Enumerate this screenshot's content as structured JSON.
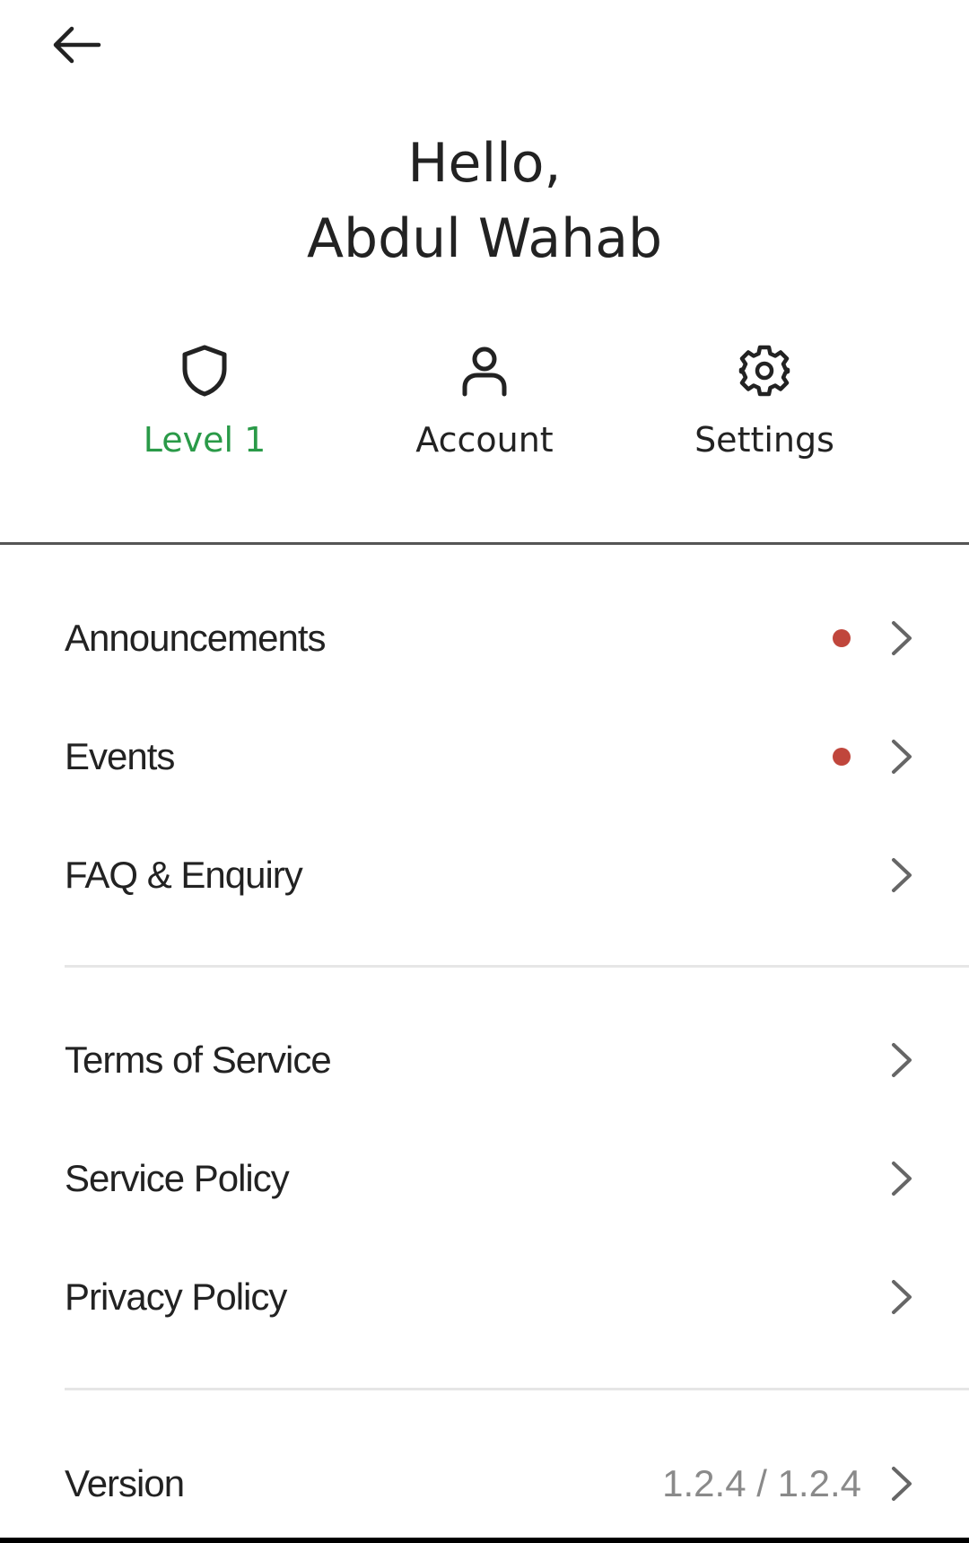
{
  "header": {
    "back_icon": "arrow-left-icon"
  },
  "greeting": {
    "line1": "Hello,",
    "line2": "Abdul Wahab"
  },
  "quick_actions": [
    {
      "label": "Level 1",
      "icon": "shield-icon",
      "color": "#2a9a48"
    },
    {
      "label": "Account",
      "icon": "user-icon",
      "color": "#222222"
    },
    {
      "label": "Settings",
      "icon": "gear-icon",
      "color": "#222222"
    }
  ],
  "menu": {
    "group1": [
      {
        "label": "Announcements",
        "has_dot": true
      },
      {
        "label": "Events",
        "has_dot": true
      },
      {
        "label": "FAQ & Enquiry",
        "has_dot": false
      }
    ],
    "group2": [
      {
        "label": "Terms of Service"
      },
      {
        "label": "Service Policy"
      },
      {
        "label": "Privacy Policy"
      }
    ],
    "version": {
      "label": "Version",
      "value": "1.2.4 / 1.2.4"
    }
  },
  "colors": {
    "accent_green": "#2a9a48",
    "notification_dot": "#c0463c",
    "text": "#222222",
    "muted": "#8a8a8a"
  }
}
